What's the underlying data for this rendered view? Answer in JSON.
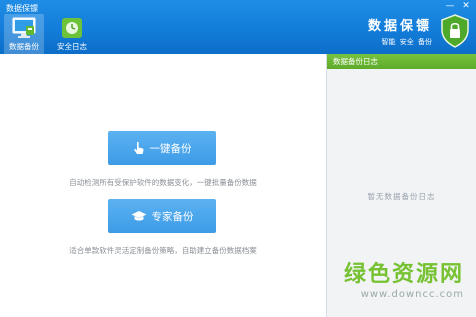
{
  "window": {
    "title": "数据保镖",
    "min_icon": "minimize-icon",
    "close_icon": "close-icon"
  },
  "nav": [
    {
      "label": "数据备份",
      "icon": "monitor-icon",
      "active": true
    },
    {
      "label": "安全日志",
      "icon": "clock-log-icon",
      "active": false
    }
  ],
  "brand": {
    "name": "数据保镖",
    "tags": "智能 安全 备份",
    "icon": "shield-lock-icon"
  },
  "main": {
    "one_click": {
      "label": "一键备份",
      "icon": "hand-pointer-icon",
      "desc": "自动检测所有受保护软件的数据变化，一键批量备份数据"
    },
    "expert": {
      "label": "专家备份",
      "icon": "graduation-cap-icon",
      "desc": "适合单款软件灵活定制备份策略，自助建立备份数据档案"
    }
  },
  "side": {
    "title": "数据备份日志",
    "empty_text": "暂无数据备份日志"
  },
  "watermark": {
    "main": "绿色资源网",
    "url": "www.downcc.com"
  },
  "colors": {
    "header": "#137dd9",
    "button": "#4aa6ec",
    "side_head": "#68b532",
    "watermark": "#77c232"
  }
}
